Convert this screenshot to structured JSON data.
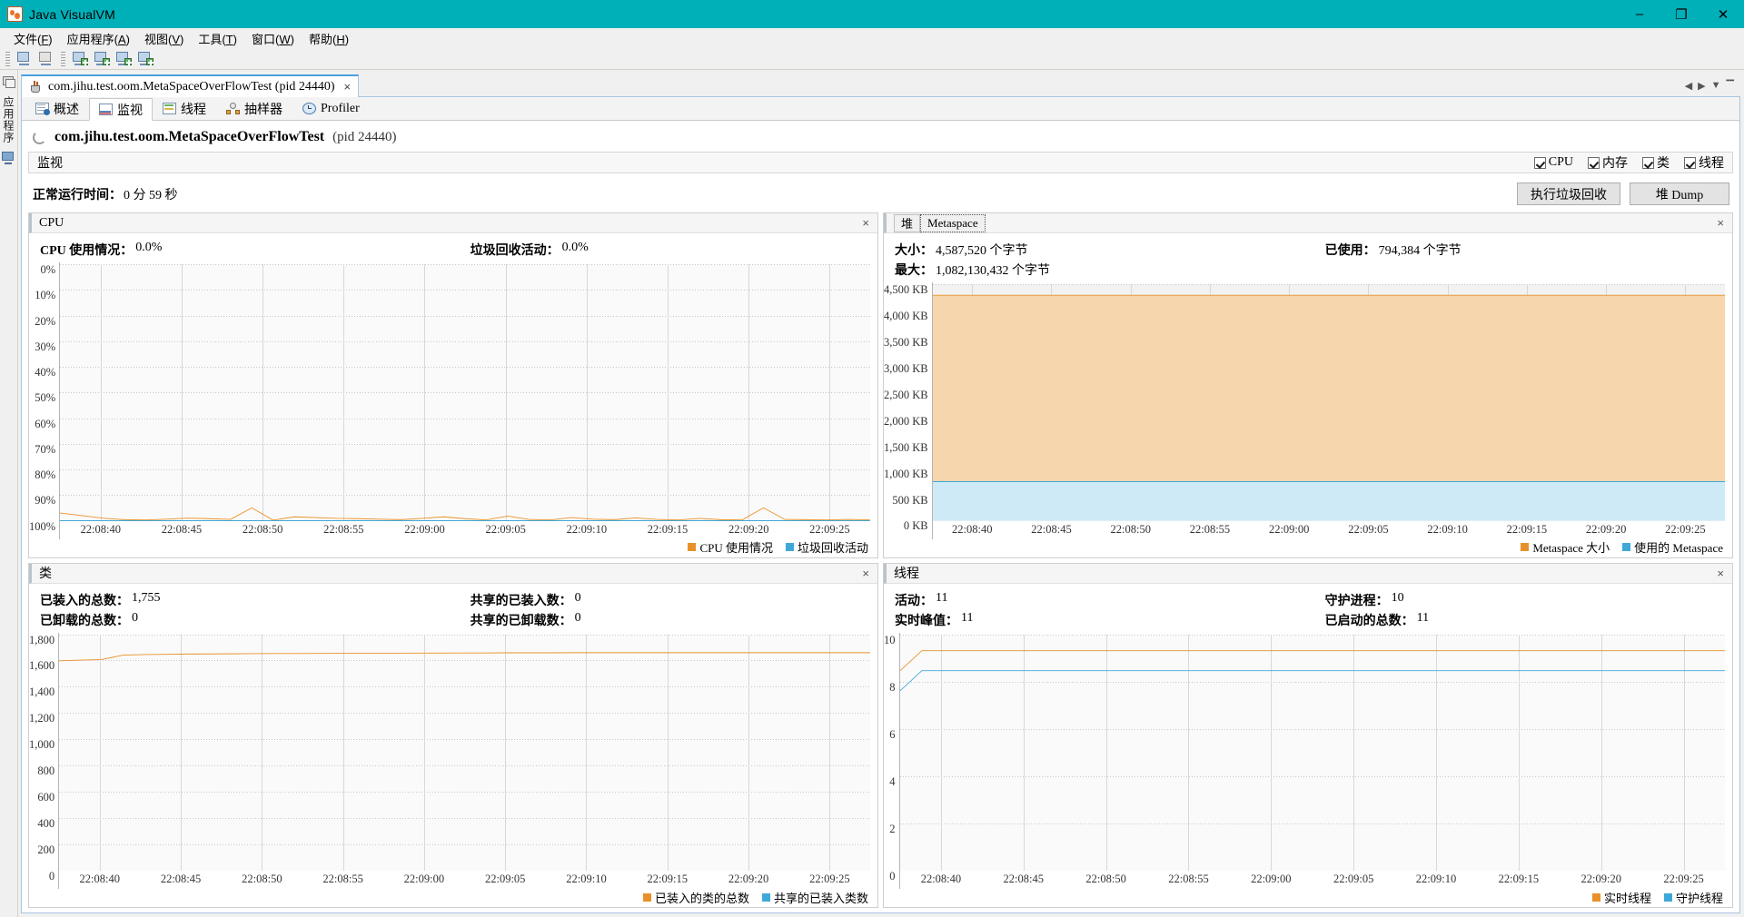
{
  "window": {
    "title": "Java VisualVM",
    "app_icon": "visualvm-icon",
    "minimize_label": "–",
    "maximize_label": "❐",
    "close_label": "✕"
  },
  "menubar": [
    {
      "name": "file",
      "text_before": "文件(",
      "mnemonic": "F",
      "text_after": ")"
    },
    {
      "name": "applications",
      "text_before": "应用程序(",
      "mnemonic": "A",
      "text_after": ")"
    },
    {
      "name": "view",
      "text_before": "视图(",
      "mnemonic": "V",
      "text_after": ")"
    },
    {
      "name": "tools",
      "text_before": "工具(",
      "mnemonic": "T",
      "text_after": ")"
    },
    {
      "name": "window",
      "text_before": "窗口(",
      "mnemonic": "W",
      "text_after": ")"
    },
    {
      "name": "help",
      "text_before": "帮助(",
      "mnemonic": "H",
      "text_after": ")"
    }
  ],
  "toolbar": {
    "buttons": [
      "open-snapshot-icon",
      "save-snapshot-icon",
      "add-jmx-connection-icon",
      "add-remote-host-icon",
      "add-vm-coredump-icon",
      "add-application-icon"
    ]
  },
  "leftstrip": {
    "applications_tab": "应用程序",
    "snapshot_icon": "snapshot-icon",
    "monitor_icon": "monitor-icon"
  },
  "doctab": {
    "label": "com.jihu.test.oom.MetaSpaceOverFlowTest (pid 24440)",
    "close": "×",
    "nav_prev": "◀",
    "nav_next": "▶",
    "nav_down": "▼",
    "nav_max": "▔"
  },
  "subtabs": [
    {
      "name": "overview",
      "label": "概述",
      "icon": "overview-icon",
      "active": false
    },
    {
      "name": "monitor",
      "label": "监视",
      "icon": "monitor-chart-icon",
      "active": true
    },
    {
      "name": "threads",
      "label": "线程",
      "icon": "threads-icon",
      "active": false
    },
    {
      "name": "sampler",
      "label": "抽样器",
      "icon": "sampler-icon",
      "active": false
    },
    {
      "name": "profiler",
      "label": "Profiler",
      "icon": "profiler-icon",
      "active": false
    }
  ],
  "app_header": {
    "name": "com.jihu.test.oom.MetaSpaceOverFlowTest",
    "pid": "(pid 24440)"
  },
  "section": {
    "title": "监视",
    "checkboxes": [
      {
        "name": "cpu",
        "label": "CPU",
        "checked": true
      },
      {
        "name": "memory",
        "label": "内存",
        "checked": true
      },
      {
        "name": "classes",
        "label": "类",
        "checked": true
      },
      {
        "name": "threads",
        "label": "线程",
        "checked": true
      }
    ]
  },
  "uptime": {
    "label": "正常运行时间：",
    "value": "0 分 59 秒"
  },
  "actions": {
    "gc_label": "执行垃圾回收",
    "heapdump_label": "堆 Dump"
  },
  "panels": {
    "cpu": {
      "title": "CPU",
      "close": "×",
      "stat1_label": "CPU 使用情况：",
      "stat1_value": "0.0%",
      "stat2_label": "垃圾回收活动：",
      "stat2_value": "0.0%",
      "legend": [
        {
          "label": "CPU 使用情况",
          "color": "#e8912a"
        },
        {
          "label": "垃圾回收活动",
          "color": "#3fa8d8"
        }
      ]
    },
    "memory": {
      "tabs": [
        {
          "name": "heap",
          "label": "堆",
          "selected": false
        },
        {
          "name": "metaspace",
          "label": "Metaspace",
          "selected": true
        }
      ],
      "close": "×",
      "size_label": "大小：",
      "size_value": "4,587,520 个字节",
      "max_label": "最大：",
      "max_value": "1,082,130,432 个字节",
      "used_label": "已使用：",
      "used_value": "794,384 个字节",
      "legend": [
        {
          "label": "Metaspace 大小",
          "color": "#e8912a"
        },
        {
          "label": "使用的 Metaspace",
          "color": "#3fa8d8"
        }
      ]
    },
    "classes": {
      "title": "类",
      "close": "×",
      "stat1_label": "已装入的总数：",
      "stat1_value": "1,755",
      "stat2_label": "已卸载的总数：",
      "stat2_value": "0",
      "stat3_label": "共享的已装入数：",
      "stat3_value": "0",
      "stat4_label": "共享的已卸载数：",
      "stat4_value": "0",
      "legend": [
        {
          "label": "已装入的类的总数",
          "color": "#e8912a"
        },
        {
          "label": "共享的已装入类数",
          "color": "#3fa8d8"
        }
      ]
    },
    "threads": {
      "title": "线程",
      "close": "×",
      "stat1_label": "活动：",
      "stat1_value": "11",
      "stat2_label": "实时峰值：",
      "stat2_value": "11",
      "stat3_label": "守护进程：",
      "stat3_value": "10",
      "stat4_label": "已启动的总数：",
      "stat4_value": "11",
      "legend": [
        {
          "label": "实时线程",
          "color": "#e8912a"
        },
        {
          "label": "守护线程",
          "color": "#3fa8d8"
        }
      ]
    }
  },
  "chart_data": [
    {
      "id": "cpu",
      "type": "line",
      "title": "CPU",
      "xlabel": "",
      "ylabel": "",
      "ylim": [
        0,
        100
      ],
      "yticks": [
        "0%",
        "10%",
        "20%",
        "30%",
        "40%",
        "50%",
        "60%",
        "70%",
        "80%",
        "90%",
        "100%"
      ],
      "xticks": [
        "22:08:40",
        "22:08:45",
        "22:08:50",
        "22:08:55",
        "22:09:00",
        "22:09:05",
        "22:09:10",
        "22:09:15",
        "22:09:20",
        "22:09:25"
      ],
      "grid": true,
      "legend_position": "bottom-right",
      "series": [
        {
          "name": "CPU 使用情况",
          "color": "#e8912a",
          "values": [
            3,
            2,
            1,
            0.4,
            0.3,
            0.6,
            1,
            0.8,
            0.5,
            5,
            0.2,
            1.5,
            1.2,
            0.9,
            0.8,
            0.6,
            0.4,
            0.9,
            1.5,
            0.8,
            0.3,
            1.8,
            0.5,
            0.3,
            1.2,
            0.6,
            0.4,
            1.1,
            0.5,
            0.3,
            0.9,
            0.4,
            0.3,
            5,
            0.5,
            0.4,
            0.3,
            0.5,
            0.3
          ]
        },
        {
          "name": "垃圾回收活动",
          "color": "#3fa8d8",
          "values": [
            0,
            0,
            0,
            0,
            0,
            0,
            0,
            0,
            0,
            0,
            0,
            0,
            0,
            0,
            0,
            0,
            0,
            0,
            0,
            0,
            0,
            0,
            0,
            0,
            0,
            0,
            0,
            0,
            0,
            0,
            0,
            0,
            0,
            0,
            0,
            0,
            0,
            0,
            0
          ]
        }
      ]
    },
    {
      "id": "metaspace",
      "type": "area",
      "title": "Metaspace",
      "ylim": [
        0,
        4700
      ],
      "yunit": "KB",
      "yticks": [
        "4,500 KB",
        "4,000 KB",
        "3,500 KB",
        "3,000 KB",
        "2,500 KB",
        "2,000 KB",
        "1,500 KB",
        "1,000 KB",
        "500 KB",
        "0 KB"
      ],
      "xticks": [
        "22:08:40",
        "22:08:45",
        "22:08:50",
        "22:08:55",
        "22:09:00",
        "22:09:05",
        "22:09:10",
        "22:09:15",
        "22:09:20",
        "22:09:25"
      ],
      "grid": true,
      "legend_position": "bottom-right",
      "series": [
        {
          "name": "Metaspace 大小",
          "color": "#e8912a",
          "fill": "#f6d6ac",
          "constant": 4480
        },
        {
          "name": "使用的 Metaspace",
          "color": "#3fa8d8",
          "fill": "#cfeaf7",
          "constant": 776
        }
      ]
    },
    {
      "id": "classes",
      "type": "line",
      "title": "类",
      "ylim": [
        0,
        1900
      ],
      "yticks": [
        "1,800",
        "1,600",
        "1,400",
        "1,200",
        "1,000",
        "800",
        "600",
        "400",
        "200",
        "0"
      ],
      "xticks": [
        "22:08:40",
        "22:08:45",
        "22:08:50",
        "22:08:55",
        "22:09:00",
        "22:09:05",
        "22:09:10",
        "22:09:15",
        "22:09:20",
        "22:09:25"
      ],
      "grid": true,
      "legend_position": "bottom-right",
      "series": [
        {
          "name": "已装入的类的总数",
          "color": "#e8912a",
          "values": [
            1690,
            1695,
            1700,
            1735,
            1740,
            1742,
            1744,
            1745,
            1746,
            1747,
            1748,
            1748,
            1749,
            1750,
            1750,
            1751,
            1751,
            1752,
            1752,
            1753,
            1753,
            1754,
            1754,
            1754,
            1755,
            1755,
            1755,
            1755,
            1755,
            1755,
            1755,
            1755,
            1755,
            1755,
            1755,
            1755,
            1755,
            1755,
            1755
          ]
        },
        {
          "name": "共享的已装入类数",
          "color": "#3fa8d8",
          "values": [
            0,
            0,
            0,
            0,
            0,
            0,
            0,
            0,
            0,
            0,
            0,
            0,
            0,
            0,
            0,
            0,
            0,
            0,
            0,
            0,
            0,
            0,
            0,
            0,
            0,
            0,
            0,
            0,
            0,
            0,
            0,
            0,
            0,
            0,
            0,
            0,
            0,
            0,
            0
          ]
        }
      ]
    },
    {
      "id": "threads",
      "type": "line",
      "title": "线程",
      "ylim": [
        0,
        11.8
      ],
      "yticks": [
        "10",
        "8",
        "6",
        "4",
        "2",
        "0"
      ],
      "xticks": [
        "22:08:40",
        "22:08:45",
        "22:08:50",
        "22:08:55",
        "22:09:00",
        "22:09:05",
        "22:09:10",
        "22:09:15",
        "22:09:20",
        "22:09:25"
      ],
      "grid": true,
      "legend_position": "bottom-right",
      "series": [
        {
          "name": "实时线程",
          "color": "#e8912a",
          "values": [
            10,
            11,
            11,
            11,
            11,
            11,
            11,
            11,
            11,
            11,
            11,
            11,
            11,
            11,
            11,
            11,
            11,
            11,
            11,
            11,
            11,
            11,
            11,
            11,
            11,
            11,
            11,
            11,
            11,
            11,
            11,
            11,
            11,
            11,
            11,
            11,
            11,
            11,
            11
          ]
        },
        {
          "name": "守护线程",
          "color": "#3fa8d8",
          "values": [
            9,
            10,
            10,
            10,
            10,
            10,
            10,
            10,
            10,
            10,
            10,
            10,
            10,
            10,
            10,
            10,
            10,
            10,
            10,
            10,
            10,
            10,
            10,
            10,
            10,
            10,
            10,
            10,
            10,
            10,
            10,
            10,
            10,
            10,
            10,
            10,
            10,
            10,
            10
          ]
        }
      ]
    }
  ]
}
